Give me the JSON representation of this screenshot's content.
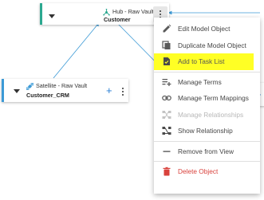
{
  "canvas": {
    "hub_node": {
      "type_label": "Hub - Raw Vault",
      "name": "Customer",
      "type_icon": "hub-icon",
      "accent_color": "#2ca890"
    },
    "satellite_node": {
      "type_label": "Satellite - Raw Vault",
      "name": "Customer_CRM",
      "type_icon": "satellite-icon",
      "accent_color": "#3c9ad6",
      "add_label": "+"
    },
    "third_node": {
      "add_label": "+",
      "accent_color": "#3c9ad6"
    },
    "connector_color": "#3c9ad6"
  },
  "context_menu": {
    "items": [
      {
        "label": "Edit Model Object",
        "icon": "edit-icon",
        "state": "enabled"
      },
      {
        "label": "Duplicate Model Object",
        "icon": "duplicate-icon",
        "state": "enabled"
      },
      {
        "label": "Add to Task List",
        "icon": "task-list-icon",
        "state": "highlighted"
      },
      {
        "label": "Manage Terms",
        "icon": "terms-icon",
        "state": "enabled"
      },
      {
        "label": "Manage Term Mappings",
        "icon": "link-icon",
        "state": "enabled"
      },
      {
        "label": "Manage Relationships",
        "icon": "relationships-icon",
        "state": "disabled"
      },
      {
        "label": "Show Relationship",
        "icon": "show-relationship-icon",
        "state": "enabled"
      },
      {
        "label": "Remove from View",
        "icon": "remove-icon",
        "state": "enabled"
      },
      {
        "label": "Delete Object",
        "icon": "trash-icon",
        "state": "danger"
      }
    ],
    "highlight_color": "#ffff25",
    "danger_color": "#d9423c"
  }
}
